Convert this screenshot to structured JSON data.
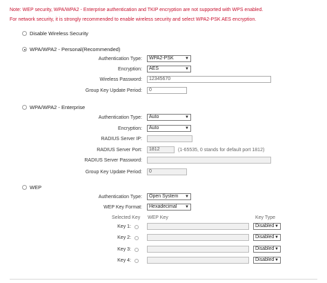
{
  "notes": {
    "line1": "Note: WEP security, WPA/WPA2 - Enterprise authentication and TKIP encryption are not supported with WPS enabled.",
    "line2": "For network security, it is strongly recommended to enable wireless security and select WPA2-PSK AES encryption."
  },
  "options": {
    "disable": "Disable Wireless Security",
    "personal": "WPA/WPA2 - Personal(Recommended)",
    "enterprise": "WPA/WPA2 - Enterprise",
    "wep": "WEP"
  },
  "personal": {
    "auth_type_label": "Authentication Type:",
    "auth_type_value": "WPA2-PSK",
    "encryption_label": "Encryption:",
    "encryption_value": "AES",
    "password_label": "Wireless Password:",
    "password_value": "12345670",
    "group_key_label": "Group Key Update Period:",
    "group_key_value": "0"
  },
  "enterprise": {
    "auth_type_label": "Authentication Type:",
    "auth_type_value": "Auto",
    "encryption_label": "Encryption:",
    "encryption_value": "Auto",
    "radius_ip_label": "RADIUS Server IP:",
    "radius_ip_value": "",
    "radius_port_label": "RADIUS Server Port:",
    "radius_port_value": "1812",
    "radius_port_hint": "(1-65535, 0 stands for default port 1812)",
    "radius_password_label": "RADIUS Server Password:",
    "radius_password_value": "",
    "group_key_label": "Group Key Update Period:",
    "group_key_value": "0"
  },
  "wep": {
    "auth_type_label": "Authentication Type:",
    "auth_type_value": "Open System",
    "key_format_label": "WEP Key Format:",
    "key_format_value": "Hexadecimal",
    "col_selected": "Selected Key",
    "col_wep_key": "WEP Key",
    "col_key_type": "Key Type",
    "keys": [
      {
        "label": "Key 1:",
        "value": "",
        "type": "Disabled"
      },
      {
        "label": "Key 2:",
        "value": "",
        "type": "Disabled"
      },
      {
        "label": "Key 3:",
        "value": "",
        "type": "Disabled"
      },
      {
        "label": "Key 4:",
        "value": "",
        "type": "Disabled"
      }
    ]
  },
  "icons": {
    "dropdown": "chevron-down-icon"
  }
}
